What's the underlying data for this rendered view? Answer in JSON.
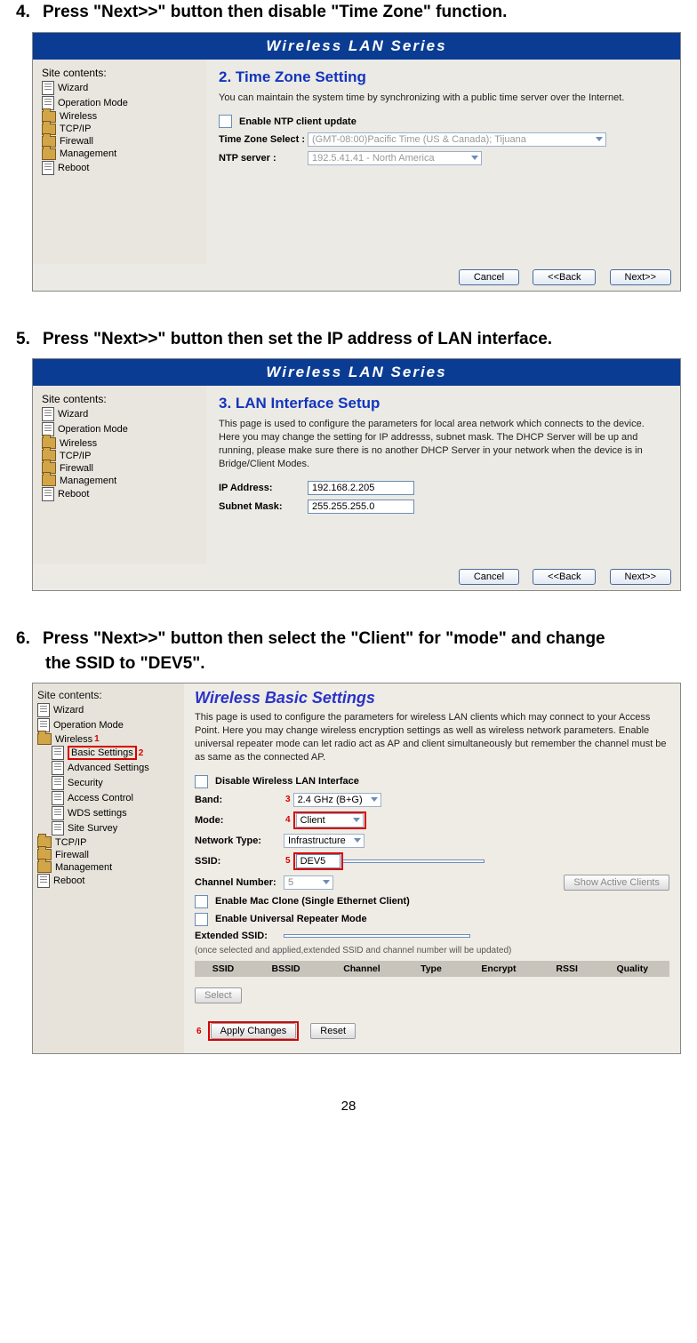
{
  "steps": {
    "s4": "Press \"Next>>\" button then disable \"Time Zone\" function.",
    "s5": "Press \"Next>>\" button then set the IP address of LAN interface.",
    "s6a": "Press \"Next>>\" button then select the \"Client\" for \"mode\" and change",
    "s6b": "the SSID to \"DEV5\"."
  },
  "n4": "4.",
  "n5": "5.",
  "n6": "6.",
  "wlsTitle": "Wireless LAN Series",
  "sidebar": {
    "head": "Site contents:",
    "items": [
      "Wizard",
      "Operation Mode",
      "Wireless",
      "TCP/IP",
      "Firewall",
      "Management",
      "Reboot"
    ]
  },
  "tz": {
    "title": "2.  Time Zone Setting",
    "desc": "You can maintain the system time by synchronizing with a public time server over the Internet.",
    "enable": "Enable NTP client update",
    "tzlabel": "Time Zone Select :",
    "tzval": "(GMT-08:00)Pacific Time (US & Canada); Tijuana",
    "ntplabel": "NTP server :",
    "ntpval": "192.5.41.41 - North America"
  },
  "lan": {
    "title": "3.  LAN Interface Setup",
    "desc": "This page is used to configure the parameters for local area network which connects to the device. Here you may change the setting for IP addresss, subnet mask. The DHCP Server will be up and running, please make sure there is no another DHCP Server in your network when the device is in Bridge/Client Modes.",
    "iplabel": "IP Address:",
    "ipval": "192.168.2.205",
    "smlabel": "Subnet Mask:",
    "smval": "255.255.255.0"
  },
  "btns": {
    "cancel": "Cancel",
    "back": "<<Back",
    "next": "Next>>"
  },
  "wbs": {
    "head": "Site contents:",
    "nav": {
      "wizard": "Wizard",
      "opmode": "Operation Mode",
      "wireless": "Wireless",
      "basic": "Basic Settings",
      "adv": "Advanced Settings",
      "sec": "Security",
      "ac": "Access Control",
      "wds": "WDS settings",
      "survey": "Site Survey",
      "tcpip": "TCP/IP",
      "firewall": "Firewall",
      "mgmt": "Management",
      "reboot": "Reboot"
    },
    "num1": "1",
    "num2": "2",
    "num3": "3",
    "num4": "4",
    "num5": "5",
    "num6": "6",
    "title": "Wireless Basic Settings",
    "desc": "This page is used to configure the parameters for wireless LAN clients which may connect to your Access Point. Here you may change wireless encryption settings as well as wireless network parameters. Enable universal repeater mode can let radio act as AP and client simultaneously but remember the channel must be as same as the connected AP.",
    "disable": "Disable Wireless LAN Interface",
    "bandL": "Band:",
    "bandV": "2.4 GHz (B+G)",
    "modeL": "Mode:",
    "modeV": "Client",
    "ntL": "Network Type:",
    "ntV": "Infrastructure",
    "ssidL": "SSID:",
    "ssidV": "DEV5",
    "chL": "Channel Number:",
    "chV": "5",
    "showClients": "Show Active Clients",
    "mac": "Enable Mac Clone (Single Ethernet Client)",
    "urep": "Enable Universal Repeater Mode",
    "extL": "Extended SSID:",
    "extNote": "(once selected and applied,extended SSID and channel number will be updated)",
    "cols": {
      "ssid": "SSID",
      "bssid": "BSSID",
      "ch": "Channel",
      "type": "Type",
      "enc": "Encrypt",
      "rssi": "RSSI",
      "q": "Quality"
    },
    "sel": "Select",
    "apply": "Apply Changes",
    "reset": "Reset"
  },
  "pageNum": "28"
}
